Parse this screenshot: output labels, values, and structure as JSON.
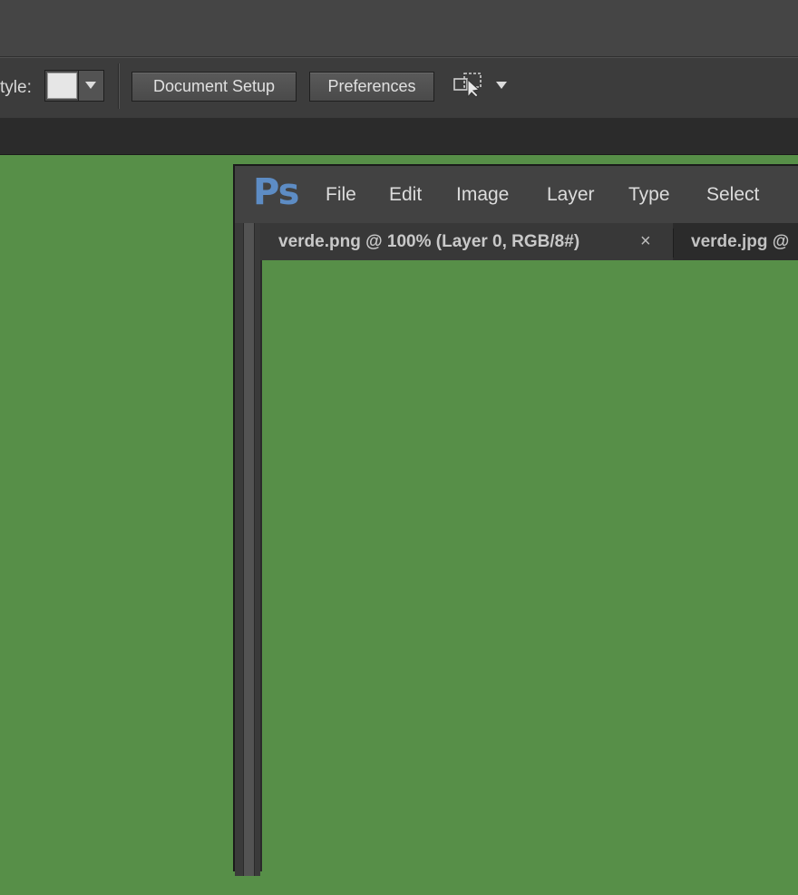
{
  "options_bar": {
    "style_label": "tyle:",
    "swatch_color": "#e6e6e6",
    "document_setup_label": "Document Setup",
    "preferences_label": "Preferences",
    "arrange_icon": "arrange-documents-icon",
    "more_icon": "chevron-down-icon"
  },
  "ps_window": {
    "logo": "Ps",
    "menu": [
      "File",
      "Edit",
      "Image",
      "Layer",
      "Type",
      "Select"
    ],
    "tabs": [
      {
        "label": "verde.png @ 100% (Layer 0, RGB/8#)",
        "close": "×",
        "active": true
      },
      {
        "label": "verde.jpg @",
        "active": false
      }
    ],
    "canvas_color": "#578f48"
  },
  "colors": {
    "workspace_green": "#578f48",
    "ps_blue": "#5d8cc4",
    "panel_dark": "#3c3c3c"
  }
}
